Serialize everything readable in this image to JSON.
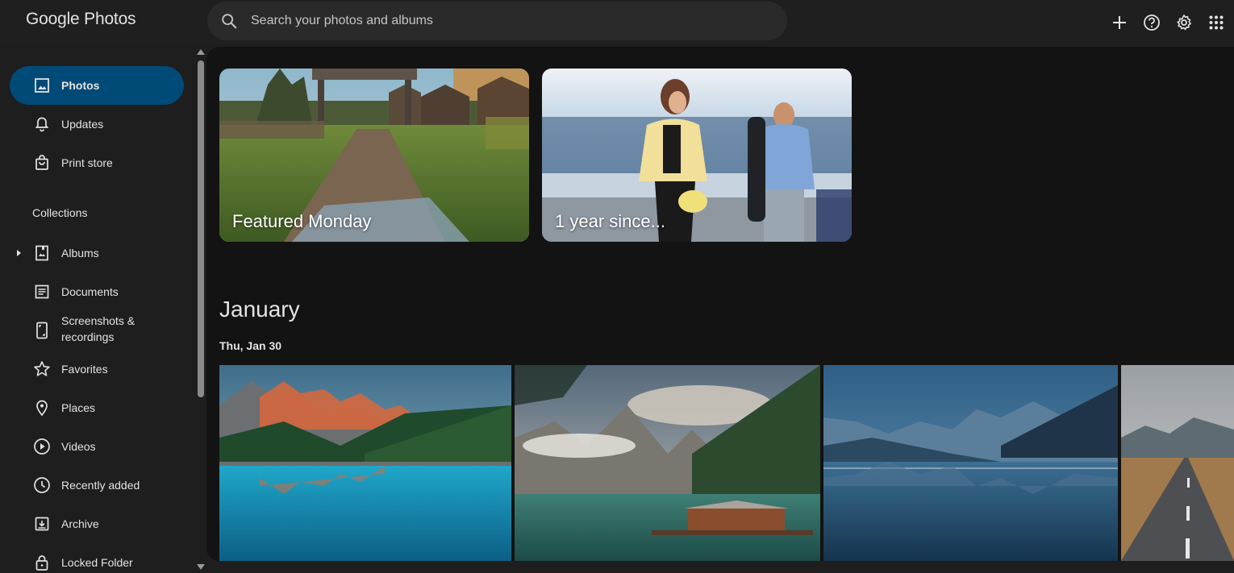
{
  "header": {
    "logo_google": "Google",
    "logo_product": "Photos",
    "search_placeholder": "Search your photos and albums",
    "icons": [
      "add-icon",
      "help-icon",
      "settings-icon",
      "apps-grid-icon"
    ]
  },
  "sidebar": {
    "items": [
      {
        "label": "Photos",
        "icon": "photo-icon",
        "active": true
      },
      {
        "label": "Updates",
        "icon": "bell-icon"
      },
      {
        "label": "Print store",
        "icon": "shopping-bag-icon"
      }
    ],
    "collections_label": "Collections",
    "collections": [
      {
        "label": "Albums",
        "icon": "album-icon"
      },
      {
        "label": "Documents",
        "icon": "document-icon"
      },
      {
        "label": "Screenshots &",
        "label2": "recordings",
        "icon": "phone-screenshot-icon"
      },
      {
        "label": "Favorites",
        "icon": "star-icon"
      },
      {
        "label": "Places",
        "icon": "location-pin-icon"
      },
      {
        "label": "Videos",
        "icon": "play-circle-icon"
      },
      {
        "label": "Recently added",
        "icon": "clock-icon"
      },
      {
        "label": "Archive",
        "icon": "archive-icon"
      },
      {
        "label": "Locked Folder",
        "icon": "lock-icon"
      }
    ]
  },
  "memories": [
    {
      "caption": "Featured Monday"
    },
    {
      "caption": "1 year since..."
    }
  ],
  "timeline": {
    "month": "January",
    "date": "Thu, Jan 30"
  },
  "colors": {
    "active_nav_bg": "#004a77",
    "background": "#1e1e1e",
    "main_bg": "#131313"
  }
}
